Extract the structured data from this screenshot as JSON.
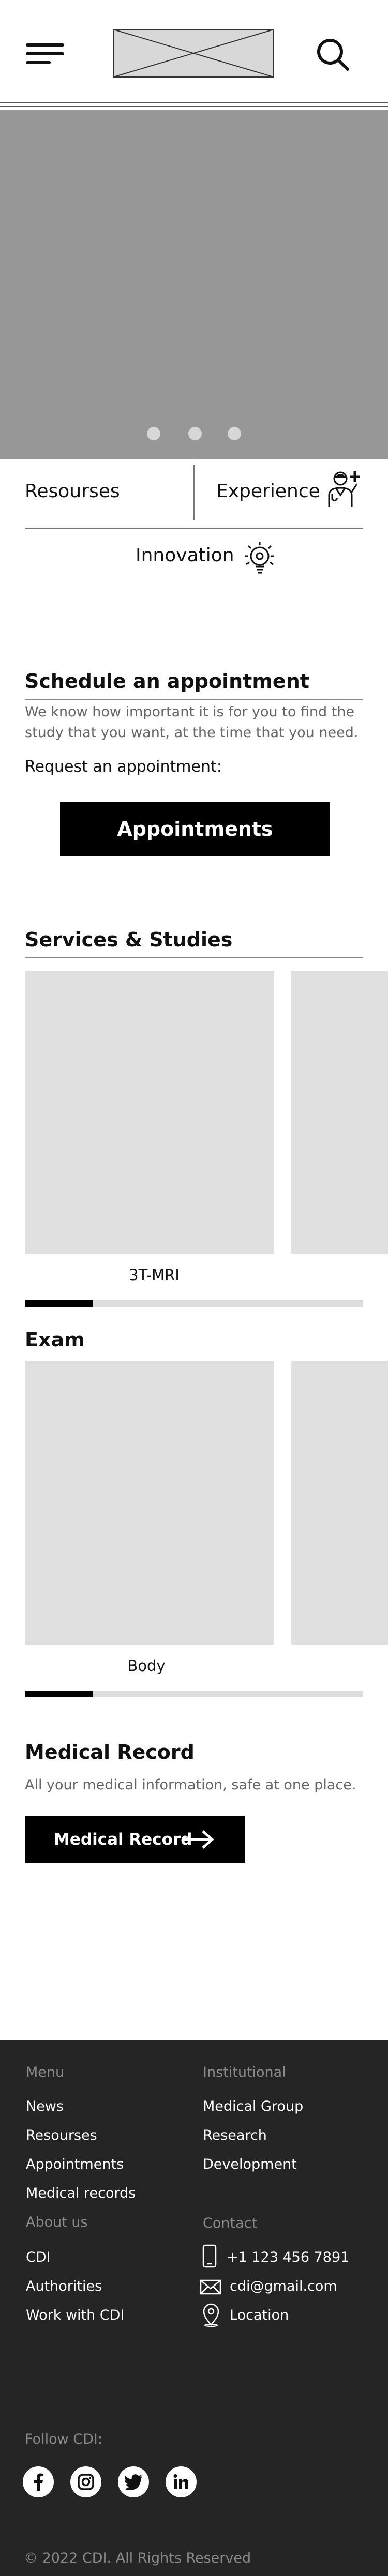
{
  "quick_links": {
    "resources": "Resourses",
    "experience": "Experience",
    "innovation": "Innovation"
  },
  "schedule": {
    "title": "Schedule an appointment",
    "description": "We know how important it is for you to find the study that you want, at the time that you need.",
    "request_label": "Request an appointment:",
    "button_label": "Appointments"
  },
  "services": {
    "title": "Services & Studies",
    "card_label": "3T-MRI",
    "progress": 0.2
  },
  "exam": {
    "title": "Exam",
    "card_label": "Body",
    "progress": 0.2
  },
  "medical_record": {
    "title": "Medical Record",
    "description": "All your medical information, safe at one place.",
    "button_label": "Medical Record"
  },
  "footer": {
    "menu_heading": "Menu",
    "menu_items": [
      "News",
      "Resourses",
      "Appointments",
      "Medical records"
    ],
    "institutional_heading": "Institutional",
    "institutional_items": [
      "Medical Group",
      "Research",
      "Development"
    ],
    "about_heading": "About us",
    "about_items": [
      "CDI",
      "Authorities",
      "Work with CDI"
    ],
    "contact_heading": "Contact",
    "phone": "+1 123 456 7891",
    "email": "cdi@gmail.com",
    "location": "Location",
    "follow_heading": "Follow CDI:",
    "social": [
      "facebook-icon",
      "instagram-icon",
      "twitter-icon",
      "linkedin-icon"
    ],
    "copyright": "© 2022 CDI. All Rights Reserved"
  },
  "hero": {
    "slide_count": 3
  }
}
